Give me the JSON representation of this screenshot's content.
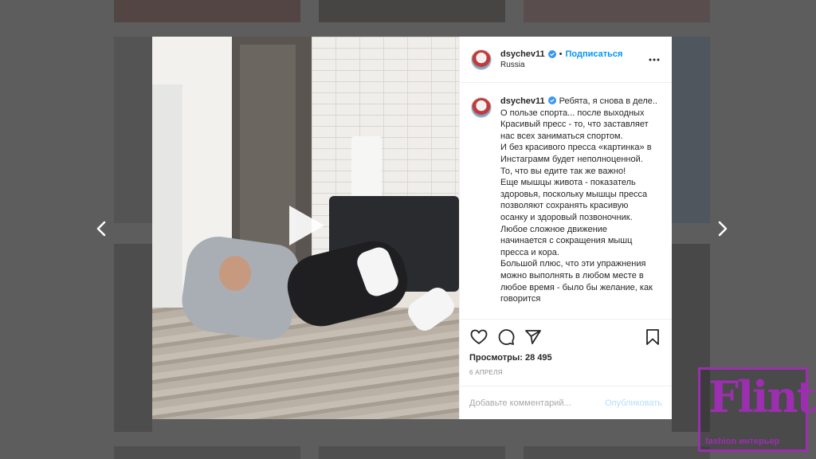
{
  "background": {
    "overlay_color": "#3c3c3c"
  },
  "navigation": {
    "prev_icon": "chevron-left-icon",
    "next_icon": "chevron-right-icon"
  },
  "post": {
    "header": {
      "username": "dsychev11",
      "separator": "•",
      "follow_label": "Подписаться",
      "location": "Russia",
      "more_icon": "more-horizontal-icon"
    },
    "caption": {
      "username": "dsychev11",
      "lines": [
        "Ребята, я снова в деле...",
        "О пользе спорта... после выходных",
        "",
        "Красивый пресс - то, что заставляет",
        "нас всех заниматься спортом.",
        "И без красивого пресса «картинка» в",
        "Инстаграмм будет неполноценной.",
        "То, что вы едите так же важно!",
        "Еще мышцы живота - показатель",
        "здоровья, поскольку мышцы пресса",
        "позволяют сохранять красивую",
        "осанку и здоровый позвоночник.",
        "Любое сложное движение",
        "начинается с сокращения мышц",
        "пресса и кора.",
        "",
        "Большой плюс, что эти упражнения",
        "можно выполнять в любом месте в",
        "любое время - было бы желание, как",
        "говорится"
      ]
    },
    "views_label": "Просмотры: 28 495",
    "date": "6 апреля",
    "comment": {
      "placeholder": "Добавьте комментарий...",
      "value": "",
      "publish_label": "Опубликовать"
    },
    "colors": {
      "link_blue": "#0095f6",
      "verified_blue": "#3897f0",
      "publish_disabled": "#b2dffc"
    }
  },
  "watermark": {
    "logo_text": "Flint",
    "tagline": "fashion интерьер",
    "color": "#9b2fb0"
  }
}
